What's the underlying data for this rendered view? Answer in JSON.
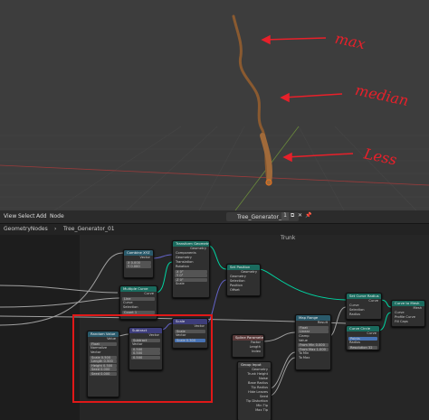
{
  "annotations": {
    "top": "max",
    "mid": "median",
    "bottom": "Less"
  },
  "header": {
    "menu": [
      "View",
      "Select",
      "Add",
      "Node"
    ],
    "node_tree_name": "Tree_Generator_01",
    "fake_user_count": "1"
  },
  "breadcrumb": {
    "modifier": "GeometryNodes",
    "tree": "Tree_Generator_01"
  },
  "frame_label": "Trunk",
  "nodes": {
    "combine_xyz": {
      "title": "Combine XYZ",
      "rows": [
        "Vector",
        "X 0.000",
        "Y 0.000",
        "Z 0.000"
      ]
    },
    "transform": {
      "title": "Transform Geometry",
      "rows": [
        "Geometry",
        "Components",
        "Geometry",
        "Translation",
        "Rotation",
        "X 0°",
        "Y 0°",
        "Z 0°",
        "Scale"
      ]
    },
    "bezier": {
      "title": "Multiple Curve",
      "rows": [
        "Curve",
        "Line",
        "Curve",
        "Selection",
        "Count 1"
      ]
    },
    "set_position": {
      "title": "Set Position",
      "rows": [
        "Geometry",
        "Geometry",
        "Selection",
        "Position",
        "Offset"
      ]
    },
    "set_radius": {
      "title": "Set Curve Radius",
      "rows": [
        "Curve",
        "Curve",
        "Selection",
        "Radius"
      ]
    },
    "curve_to_mesh": {
      "title": "Curve to Mesh",
      "rows": [
        "Mesh",
        "Curve",
        "Profile Curve",
        "Fill Caps"
      ]
    },
    "curve_circle": {
      "title": "Curve Circle",
      "rows": [
        "Curve",
        "Points",
        "Radius",
        "Resolution 32"
      ]
    },
    "random_value": {
      "title": "Random Value",
      "rows": [
        "Value",
        "Float",
        "Normalize",
        "Vector",
        "Scale 0.500",
        "Length 0.500",
        "Height 0.500",
        "Seed 0.000",
        "Seed 0.000"
      ]
    },
    "subtract": {
      "title": "Subtract",
      "rows": [
        "Vector",
        "Subtract",
        "Vector",
        "0.500",
        "0.500",
        "0.500"
      ]
    },
    "scale": {
      "title": "Scale",
      "rows": [
        "Vector",
        "Scale",
        "Vector",
        "Scale 0.300"
      ]
    },
    "spline_param": {
      "title": "Spline Parameter",
      "rows": [
        "Factor",
        "Length",
        "Index"
      ]
    },
    "map_range": {
      "title": "Map Range",
      "rows": [
        "Result",
        "Float",
        "Linear",
        "Clamp",
        "Value",
        "From Min 0.000",
        "From Max 1.000",
        "To Min",
        "To Max"
      ]
    },
    "group_input": {
      "title": "Group Input",
      "rows": [
        "Geometry",
        "Trunk Height",
        "Noise",
        "Base Radius",
        "Tip Radius",
        "Hide Leaves",
        "Seed",
        "Tip Distortion",
        "Min Tip",
        "Max Tip"
      ]
    }
  },
  "colors": {
    "geometry_header": "#1a6b5e",
    "vector_header": "#3d3d7a",
    "float_header": "#5a3a3a",
    "converter_header": "#2a5a6b",
    "annotation": "#e8202a",
    "trunk": "#8a5a30"
  }
}
